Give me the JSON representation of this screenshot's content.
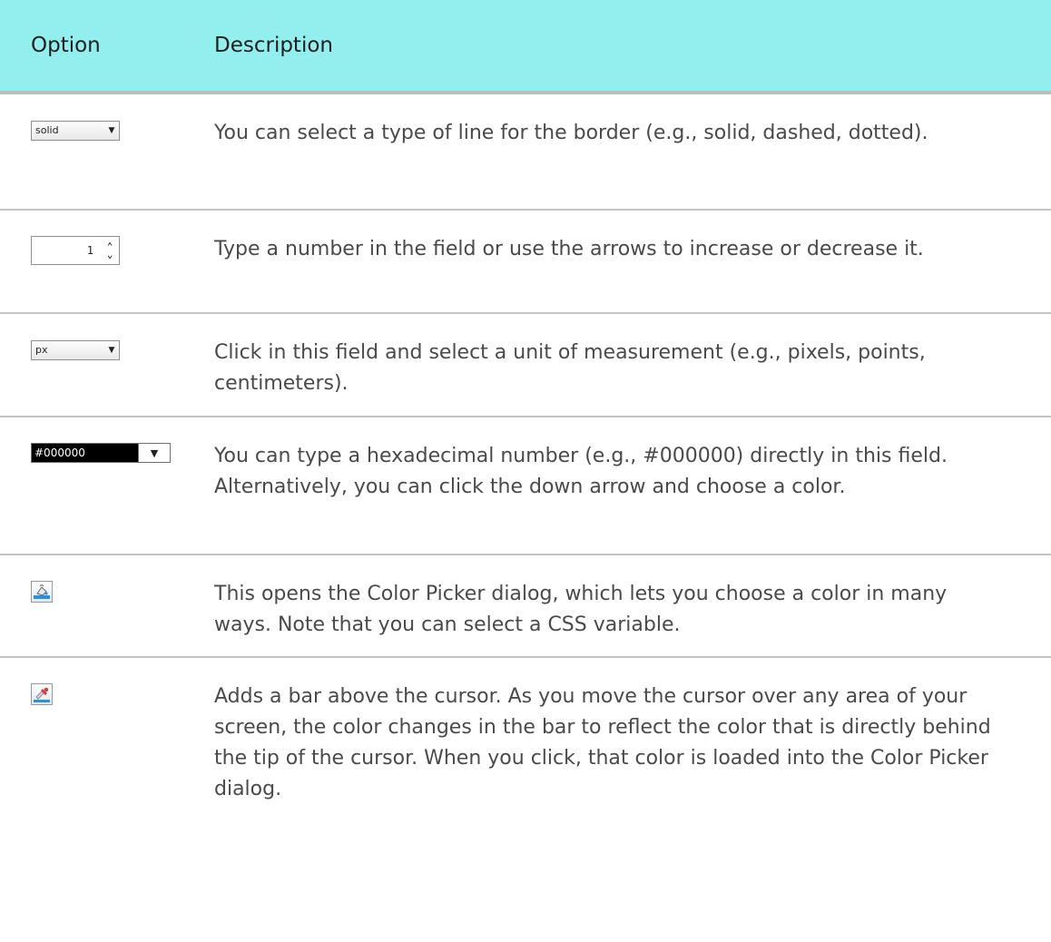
{
  "table": {
    "headers": {
      "option": "Option",
      "description": "Description"
    },
    "rows": [
      {
        "widget": "dropdown",
        "value": "solid",
        "description": "You can select a type of line for the border (e.g., solid, dashed, dotted)."
      },
      {
        "widget": "spinner",
        "value": "1",
        "description": "Type a number in the field or use the arrows to increase or decrease it."
      },
      {
        "widget": "dropdown",
        "value": "px",
        "description": "Click in this field and select a unit of measurement (e.g., pixels, points, centimeters)."
      },
      {
        "widget": "color-dropdown",
        "value": "#000000",
        "description": "You can type a hexadecimal number (e.g., #000000) directly in this field. Alternatively, you can click the down arrow and choose a color."
      },
      {
        "widget": "color-picker-button",
        "icon": "paint-bucket-icon",
        "description": "This opens the Color Picker dialog, which lets you choose a color in many ways. Note that you can select a CSS variable."
      },
      {
        "widget": "eyedropper-button",
        "icon": "eyedropper-icon",
        "description": "Adds a bar above the cursor. As you move the cursor over any area of your screen, the color changes in the bar to reflect the color that is directly behind the tip of the cursor. When you click, that color is loaded into the Color Picker dialog."
      }
    ]
  },
  "colors": {
    "header_bg": "#93efed",
    "divider": "#c4c4c4",
    "text": "#4a4a4a"
  }
}
